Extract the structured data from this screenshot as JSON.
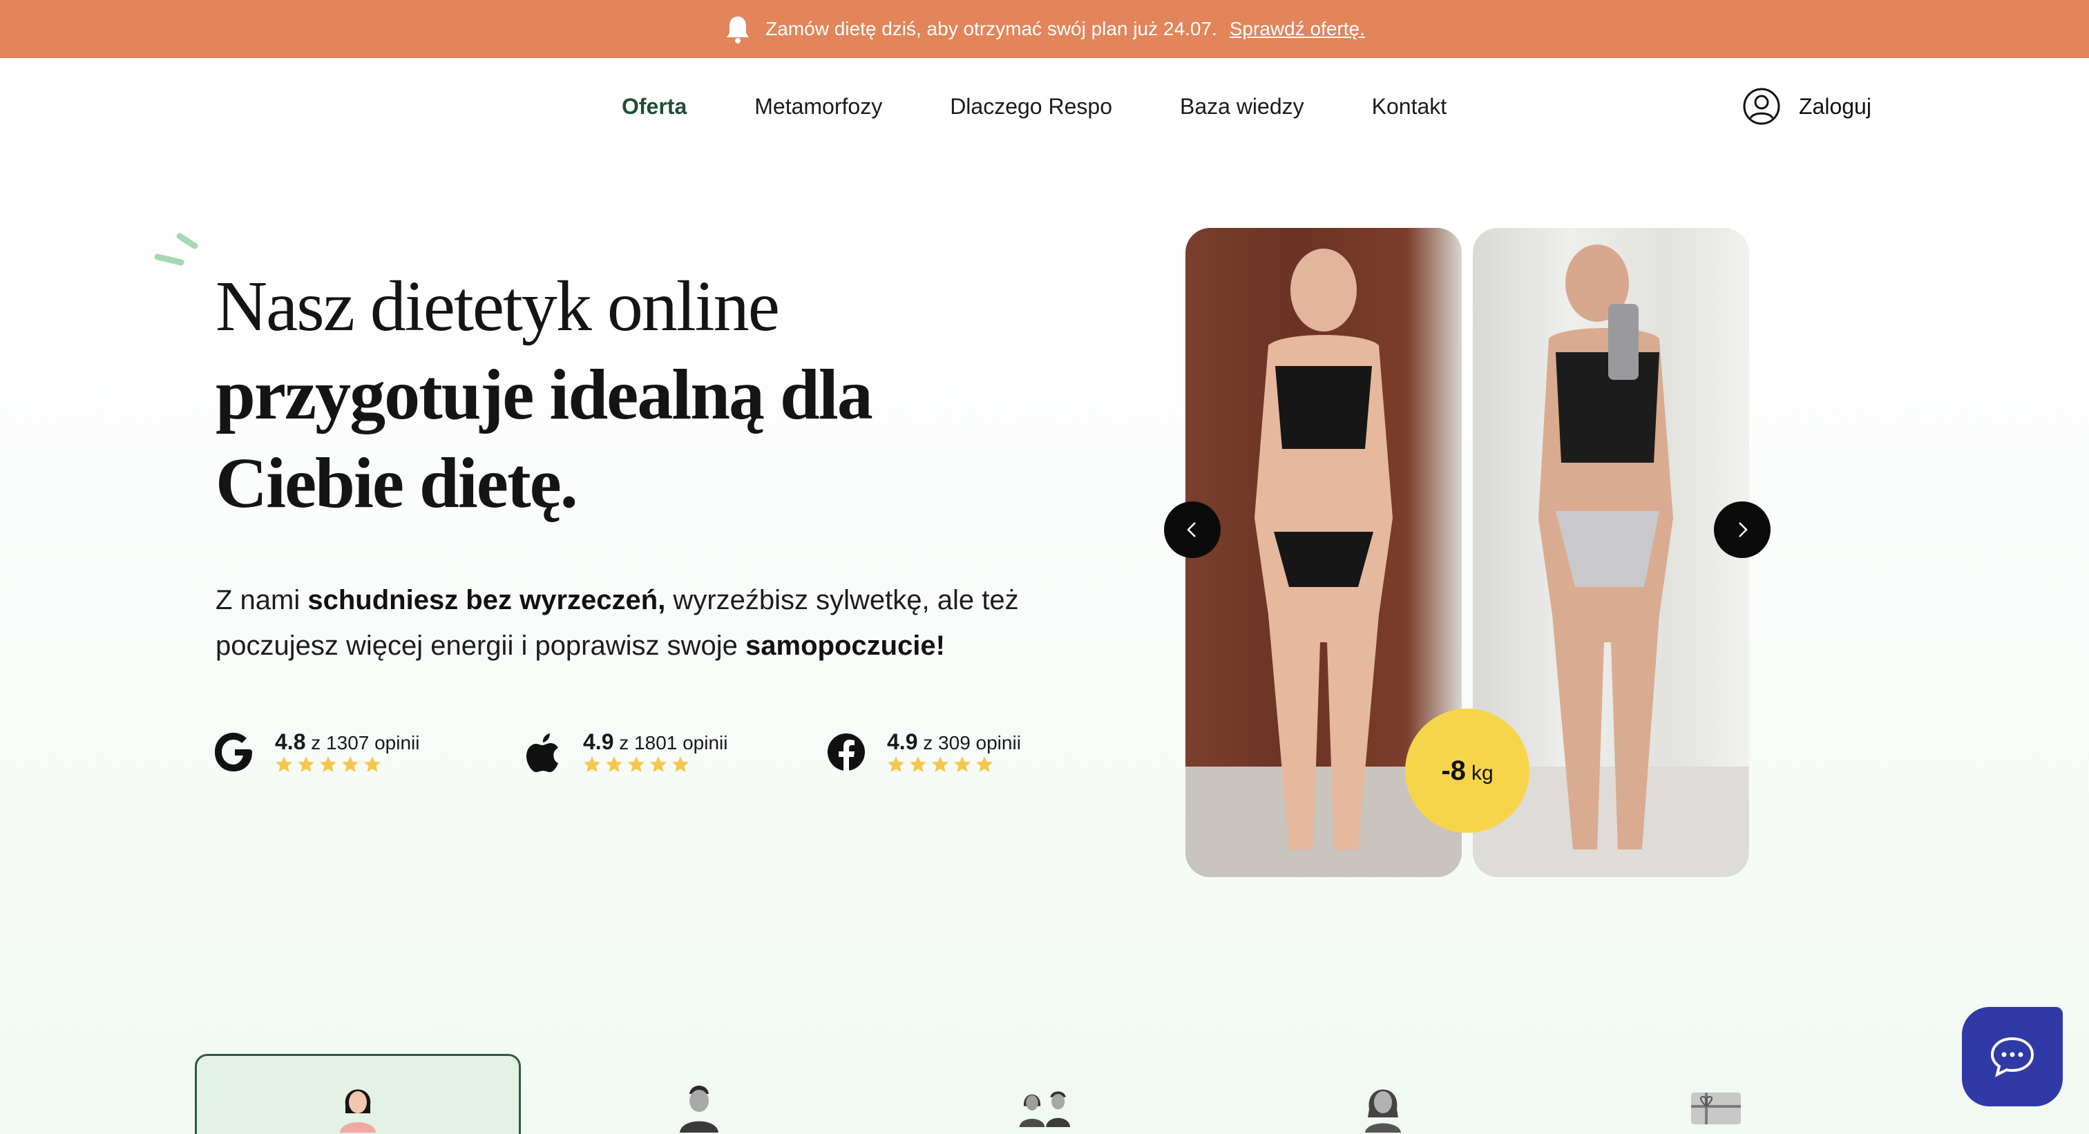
{
  "banner": {
    "text": "Zamów dietę dziś, aby otrzymać swój plan już 24.07.",
    "link": "Sprawdź ofertę.",
    "icon": "bell-icon"
  },
  "nav": {
    "links": [
      "Oferta",
      "Metamorfozy",
      "Dlaczego Respo",
      "Baza wiedzy",
      "Kontakt"
    ],
    "active": "Oferta",
    "login_label": "Zaloguj",
    "login_icon": "user-circle-icon"
  },
  "hero": {
    "title_line1": "Nasz dietetyk online",
    "title_line2": "przygotuje idealną dla",
    "title_line3": "Ciebie dietę.",
    "subtitle": {
      "p1": "Z nami ",
      "b1": "schudniesz bez wyrzeczeń,",
      "p2": " wyrzeźbisz sylwetkę, ale też poczujesz więcej energii i poprawisz swoje ",
      "b2": "samopoczucie!"
    }
  },
  "ratings": [
    {
      "source": "google-icon",
      "score": "4.8",
      "count_text": "z 1307 opinii",
      "stars": 5
    },
    {
      "source": "apple-icon",
      "score": "4.9",
      "count_text": "z 1801 opinii",
      "stars": 5
    },
    {
      "source": "facebook-icon",
      "score": "4.9",
      "count_text": "z 309 opinii",
      "stars": 5
    }
  ],
  "slider": {
    "badge_value": "-8",
    "badge_unit": "kg",
    "images": [
      "before-photo",
      "after-photo"
    ]
  },
  "tabs": {
    "icons": [
      "woman-icon",
      "man-icon",
      "couple-icon",
      "woman-alt-icon",
      "gift-card-icon"
    ],
    "active_index": 0
  },
  "colors": {
    "banner": "#e2855a",
    "accent_green": "#1f4f35",
    "badge": "#f7d54b",
    "chat": "#2f3aa6",
    "star": "#f5c84c"
  }
}
